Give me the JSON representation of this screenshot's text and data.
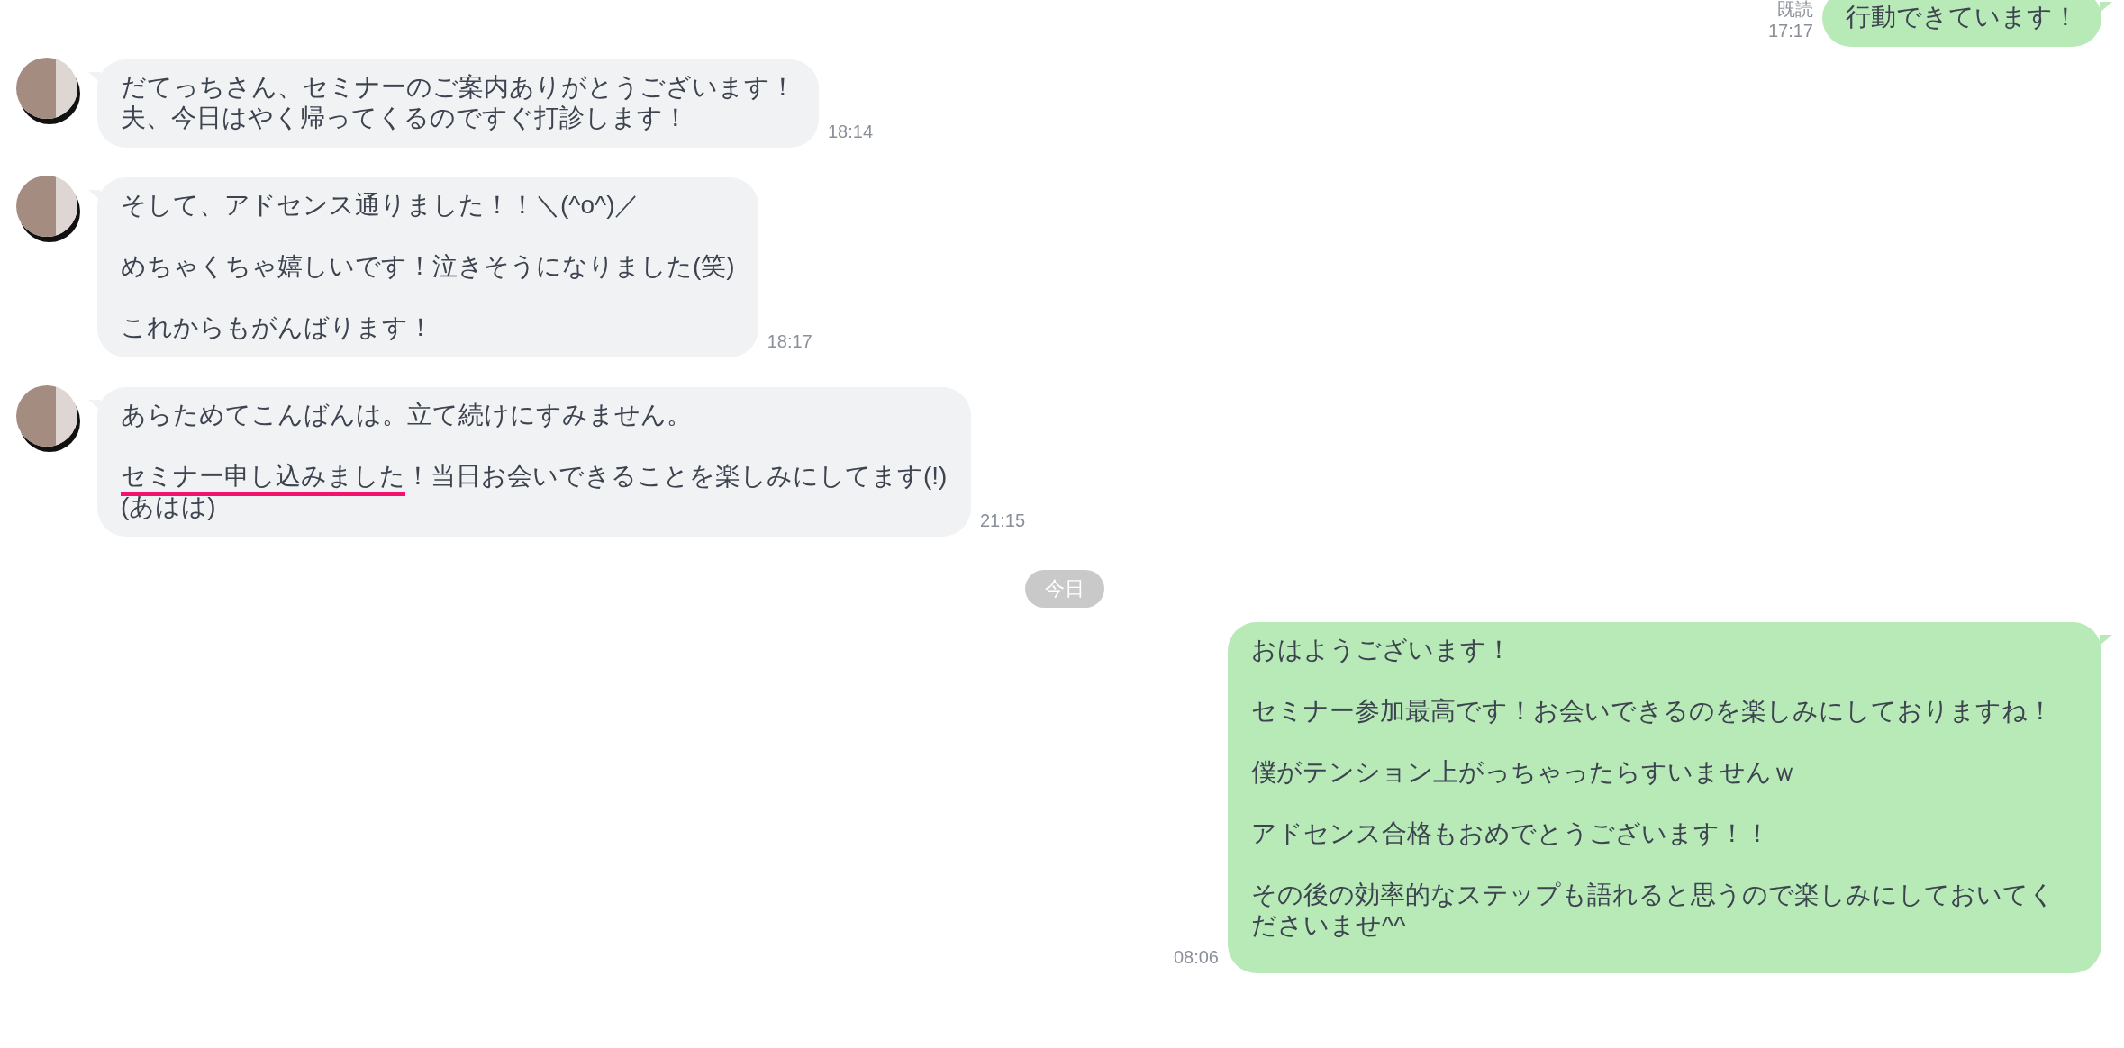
{
  "messages": [
    {
      "kind": "sent",
      "paragraphs": [
        [
          "行動できています！"
        ]
      ],
      "read": "既読",
      "time": "17:17"
    },
    {
      "kind": "received",
      "paragraphs": [
        [
          "だてっちさん、セミナーのご案内ありがとうございます！",
          "夫、今日はやく帰ってくるのですぐ打診します！"
        ]
      ],
      "time": "18:14"
    },
    {
      "kind": "received",
      "paragraphs": [
        [
          "そして、アドセンス通りました！！＼(^o^)／"
        ],
        [
          "めちゃくちゃ嬉しいです！泣きそうになりました(笑)"
        ],
        [
          "これからもがんばります！"
        ]
      ],
      "time": "18:17"
    },
    {
      "kind": "received",
      "paragraphs": [
        [
          "あらためてこんばんは。立て続けにすみません。"
        ],
        [
          {
            "parts": [
              {
                "text": "セミナー申し込みました",
                "underlined": true
              },
              {
                "text": "！当日お会いできることを楽しみにしてます(!)(あはは)",
                "underlined": false
              }
            ]
          }
        ]
      ],
      "time": "21:15"
    },
    {
      "kind": "date",
      "text": "今日"
    },
    {
      "kind": "sent",
      "paragraphs": [
        [
          "おはようございます！"
        ],
        [
          "セミナー参加最高です！お会いできるのを楽しみにしておりますね！"
        ],
        [
          "僕がテンション上がっちゃったらすいませんｗ"
        ],
        [
          "アドセンス合格もおめでとうございます！！"
        ],
        [
          "その後の効率的なステップも語れると思うので楽しみにしておいてくださいませ^^"
        ]
      ],
      "time": "08:06"
    }
  ]
}
